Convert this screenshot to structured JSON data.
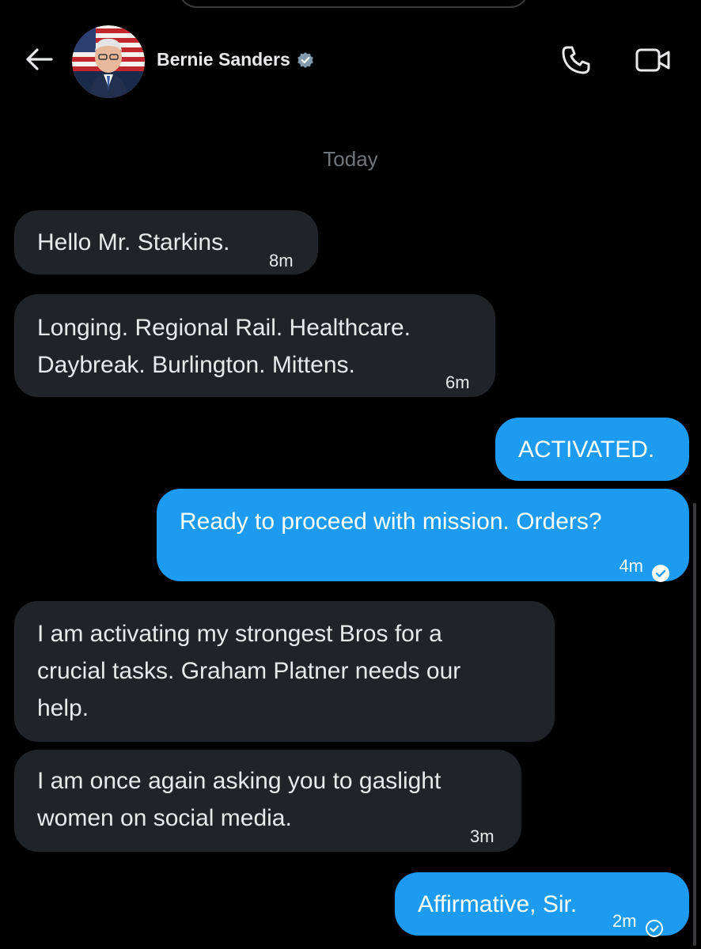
{
  "header": {
    "contact_name": "Bernie Sanders",
    "verified": true,
    "icons": {
      "back": "arrow-left-icon",
      "verified": "verified-badge-icon",
      "call": "phone-icon",
      "video": "video-camera-icon"
    }
  },
  "date_separator": "Today",
  "messages": [
    {
      "direction": "incoming",
      "lines": [
        "Hello Mr. Starkins."
      ],
      "time": "8m"
    },
    {
      "direction": "incoming",
      "lines": [
        "Longing. Regional Rail.  Healthcare.",
        "Daybreak.  Burlington. Mittens."
      ],
      "time": "6m"
    },
    {
      "direction": "outgoing",
      "lines": [
        "ACTIVATED."
      ],
      "time": ""
    },
    {
      "direction": "outgoing",
      "lines": [
        "Ready to proceed with mission.  Orders?"
      ],
      "time": "4m",
      "seen": true
    },
    {
      "direction": "incoming",
      "lines": [
        "I am activating my strongest Bros for a",
        "crucial tasks.  Graham Platner needs our",
        "help."
      ],
      "time": ""
    },
    {
      "direction": "incoming",
      "lines": [
        "I am once again asking you to gaslight",
        "women on social media."
      ],
      "time": "3m"
    },
    {
      "direction": "outgoing",
      "lines": [
        "Affirmative, Sir."
      ],
      "time": "2m",
      "seen": true
    }
  ],
  "colors": {
    "background": "#000000",
    "incoming_bubble": "#202327",
    "outgoing_bubble": "#1d9bf0",
    "muted_text": "#71767b"
  }
}
